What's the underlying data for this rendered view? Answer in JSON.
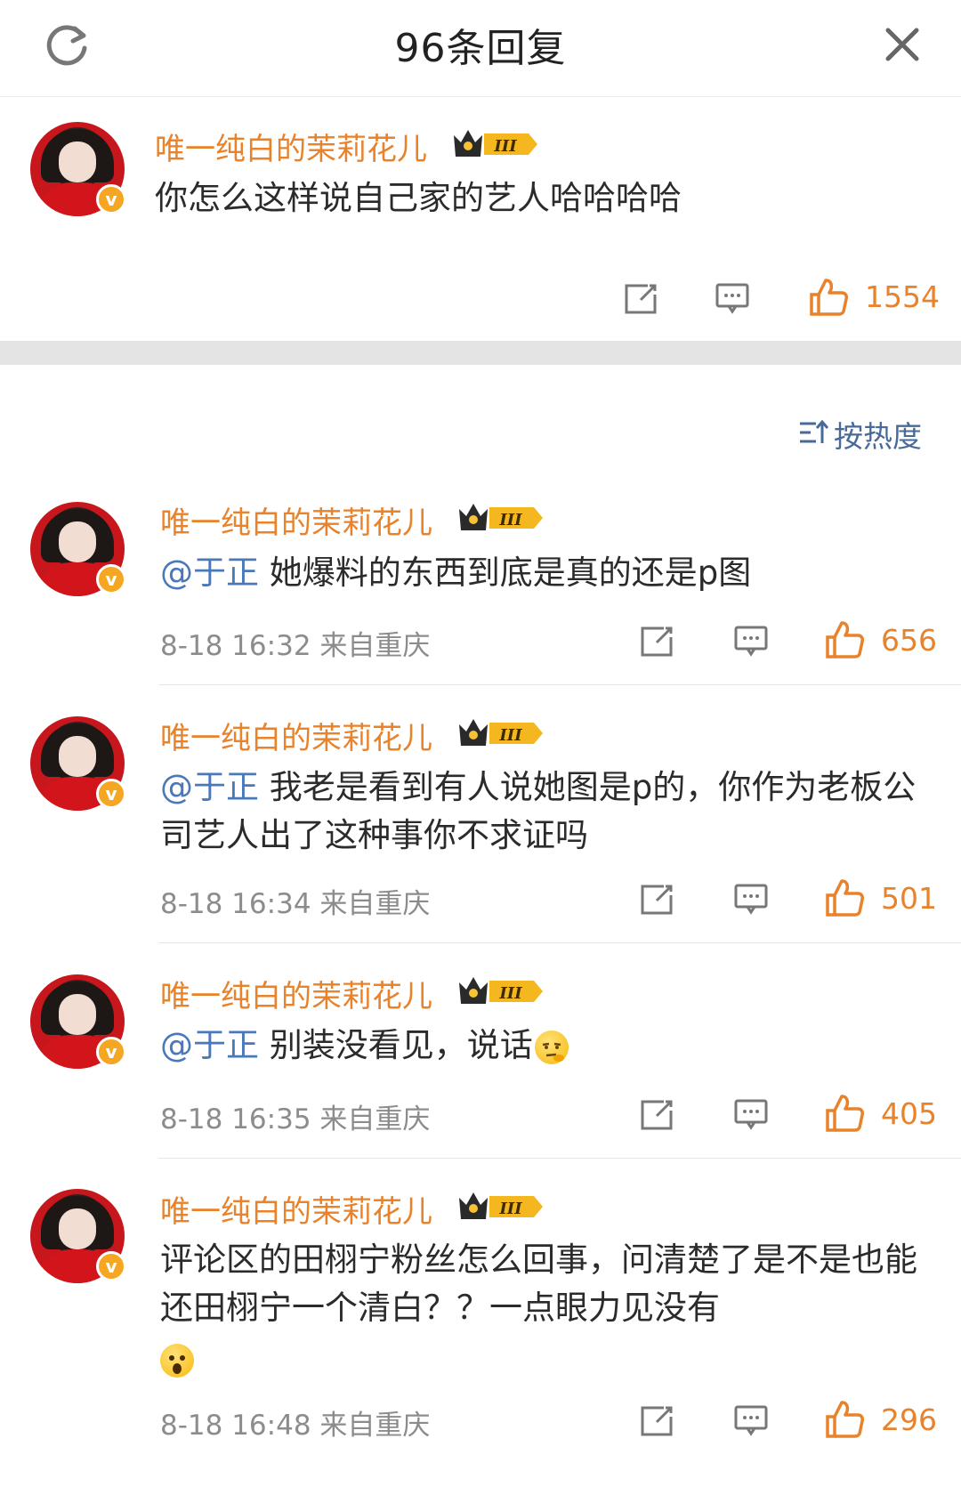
{
  "header": {
    "title": "96条回复",
    "refresh_icon": "refresh-icon",
    "close_icon": "close-icon"
  },
  "root_comment": {
    "username": "唯一纯白的茉莉花儿",
    "badge_level": "III",
    "text": "你怎么这样说自己家的艺人哈哈哈哈",
    "likes": "1554"
  },
  "sort": {
    "label": "按热度",
    "icon": "sort-icon"
  },
  "replies": [
    {
      "username": "唯一纯白的茉莉花儿",
      "badge_level": "III",
      "mention": "@于正",
      "text": " 她爆料的东西到底是真的还是p图",
      "time": "8-18 16:32",
      "location": "来自重庆",
      "likes": "656"
    },
    {
      "username": "唯一纯白的茉莉花儿",
      "badge_level": "III",
      "mention": "@于正",
      "text": " 我老是看到有人说她图是p的，你作为老板公司艺人出了这种事你不求证吗",
      "time": "8-18 16:34",
      "location": "来自重庆",
      "likes": "501"
    },
    {
      "username": "唯一纯白的茉莉花儿",
      "badge_level": "III",
      "mention": "@于正",
      "text": " 别装没看见，说话",
      "emoji": "thinking-face-emoji",
      "time": "8-18 16:35",
      "location": "来自重庆",
      "likes": "405"
    },
    {
      "username": "唯一纯白的茉莉花儿",
      "badge_level": "III",
      "mention": "",
      "text": "评论区的田栩宁粉丝怎么回事，问清楚了是不是也能还田栩宁一个清白？？一点眼力见没有",
      "emoji": "surprised-face-emoji",
      "time": "8-18 16:48",
      "location": "来自重庆",
      "likes": "296"
    }
  ],
  "colors": {
    "username": "#e8822b",
    "mention": "#4a78b8",
    "meta": "#8c8c8c",
    "like": "#e8822b",
    "sort": "#486a98",
    "band": "#e4e4e4"
  }
}
